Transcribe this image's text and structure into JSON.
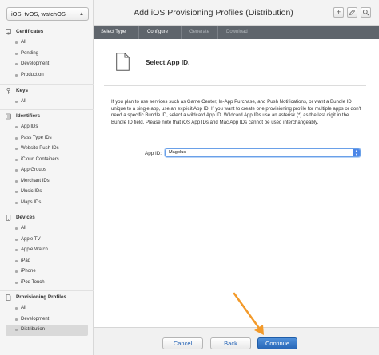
{
  "sidebar": {
    "platform": "iOS, tvOS, watchOS",
    "sections": [
      {
        "title": "Certificates",
        "icon": "certificate-icon",
        "items": [
          "All",
          "Pending",
          "Development",
          "Production"
        ]
      },
      {
        "title": "Keys",
        "icon": "key-icon",
        "items": [
          "All"
        ]
      },
      {
        "title": "Identifiers",
        "icon": "id-card-icon",
        "items": [
          "App IDs",
          "Pass Type IDs",
          "Website Push IDs",
          "iCloud Containers",
          "App Groups",
          "Merchant IDs",
          "Music IDs",
          "Maps IDs"
        ]
      },
      {
        "title": "Devices",
        "icon": "device-icon",
        "items": [
          "All",
          "Apple TV",
          "Apple Watch",
          "iPad",
          "iPhone",
          "iPod Touch"
        ]
      },
      {
        "title": "Provisioning Profiles",
        "icon": "profile-document-icon",
        "items": [
          "All",
          "Development",
          "Distribution"
        ]
      }
    ],
    "active_item": "Distribution"
  },
  "header": {
    "title": "Add iOS Provisioning Profiles (Distribution)",
    "add_label": "+"
  },
  "steps": [
    "Select Type",
    "Configure",
    "Generate",
    "Download"
  ],
  "content": {
    "section_title": "Select App ID.",
    "description": "If you plan to use services such as Game Center, In-App Purchase, and Push Notifications, or want a Bundle ID unique to a single app, use an explicit App ID. If you want to create one provisioning profile for multiple apps or don't need a specific Bundle ID, select a wildcard App ID. Wildcard App IDs use an asterisk (*) as the last digit in the Bundle ID field. Please note that iOS App IDs and Mac App IDs cannot be used interchangeably.",
    "app_id_label": "App ID:",
    "app_id_value": "Magplus"
  },
  "footer": {
    "cancel": "Cancel",
    "back": "Back",
    "continue": "Continue"
  },
  "colors": {
    "accent": "#2867b8",
    "steps_bar": "#5f656c",
    "annotation_arrow": "#f39a2a"
  }
}
